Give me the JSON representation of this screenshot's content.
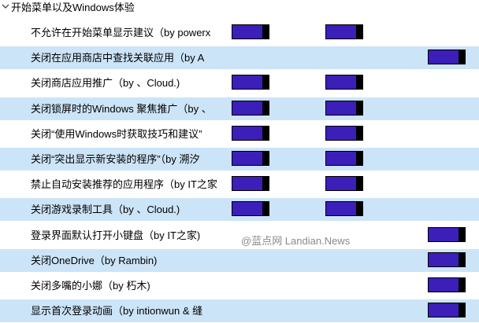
{
  "section": {
    "title": "开始菜单以及Windows体验"
  },
  "rows": [
    {
      "label": "不允许在开始菜单显示建议（by powerx",
      "col1": true,
      "col2": true,
      "col3": false,
      "highlight": false
    },
    {
      "label": "关闭在应用商店中查找关联应用（by A",
      "col1": false,
      "col2": false,
      "col3": true,
      "highlight": true
    },
    {
      "label": "关闭商店应用推广（by 、Cloud.)",
      "col1": true,
      "col2": true,
      "col3": false,
      "highlight": false
    },
    {
      "label": "关闭锁屏时的Windows 聚焦推广（by 、",
      "col1": true,
      "col2": true,
      "col3": false,
      "highlight": true
    },
    {
      "label": "关闭“使用Windows时获取技巧和建议”",
      "col1": true,
      "col2": true,
      "col3": false,
      "highlight": false
    },
    {
      "label": "关闭“突出显示新安装的程序”（by 溯汐",
      "col1": true,
      "col2": true,
      "col3": false,
      "highlight": true
    },
    {
      "label": "禁止自动安装推荐的应用程序（by IT之家",
      "col1": true,
      "col2": true,
      "col3": false,
      "highlight": false
    },
    {
      "label": "关闭游戏录制工具（by 、Cloud.)",
      "col1": true,
      "col2": true,
      "col3": false,
      "highlight": true
    },
    {
      "label": "登录界面默认打开小键盘（by IT之家)",
      "col1": false,
      "col2": false,
      "col3": true,
      "highlight": false
    },
    {
      "label": "关闭OneDrive（by Rambin)",
      "col1": false,
      "col2": false,
      "col3": true,
      "highlight": true
    },
    {
      "label": "关闭多嘴的小娜（by 朽木)",
      "col1": false,
      "col2": false,
      "col3": true,
      "highlight": false
    },
    {
      "label": "显示首次登录动画（by intionwun & 缝",
      "col1": false,
      "col2": false,
      "col3": true,
      "highlight": true
    }
  ],
  "watermark": "@蓝点网 Landian.News",
  "colors": {
    "toggle_on": "#3c1eb8",
    "highlight": "#cce4f7",
    "knob": "#000000"
  }
}
